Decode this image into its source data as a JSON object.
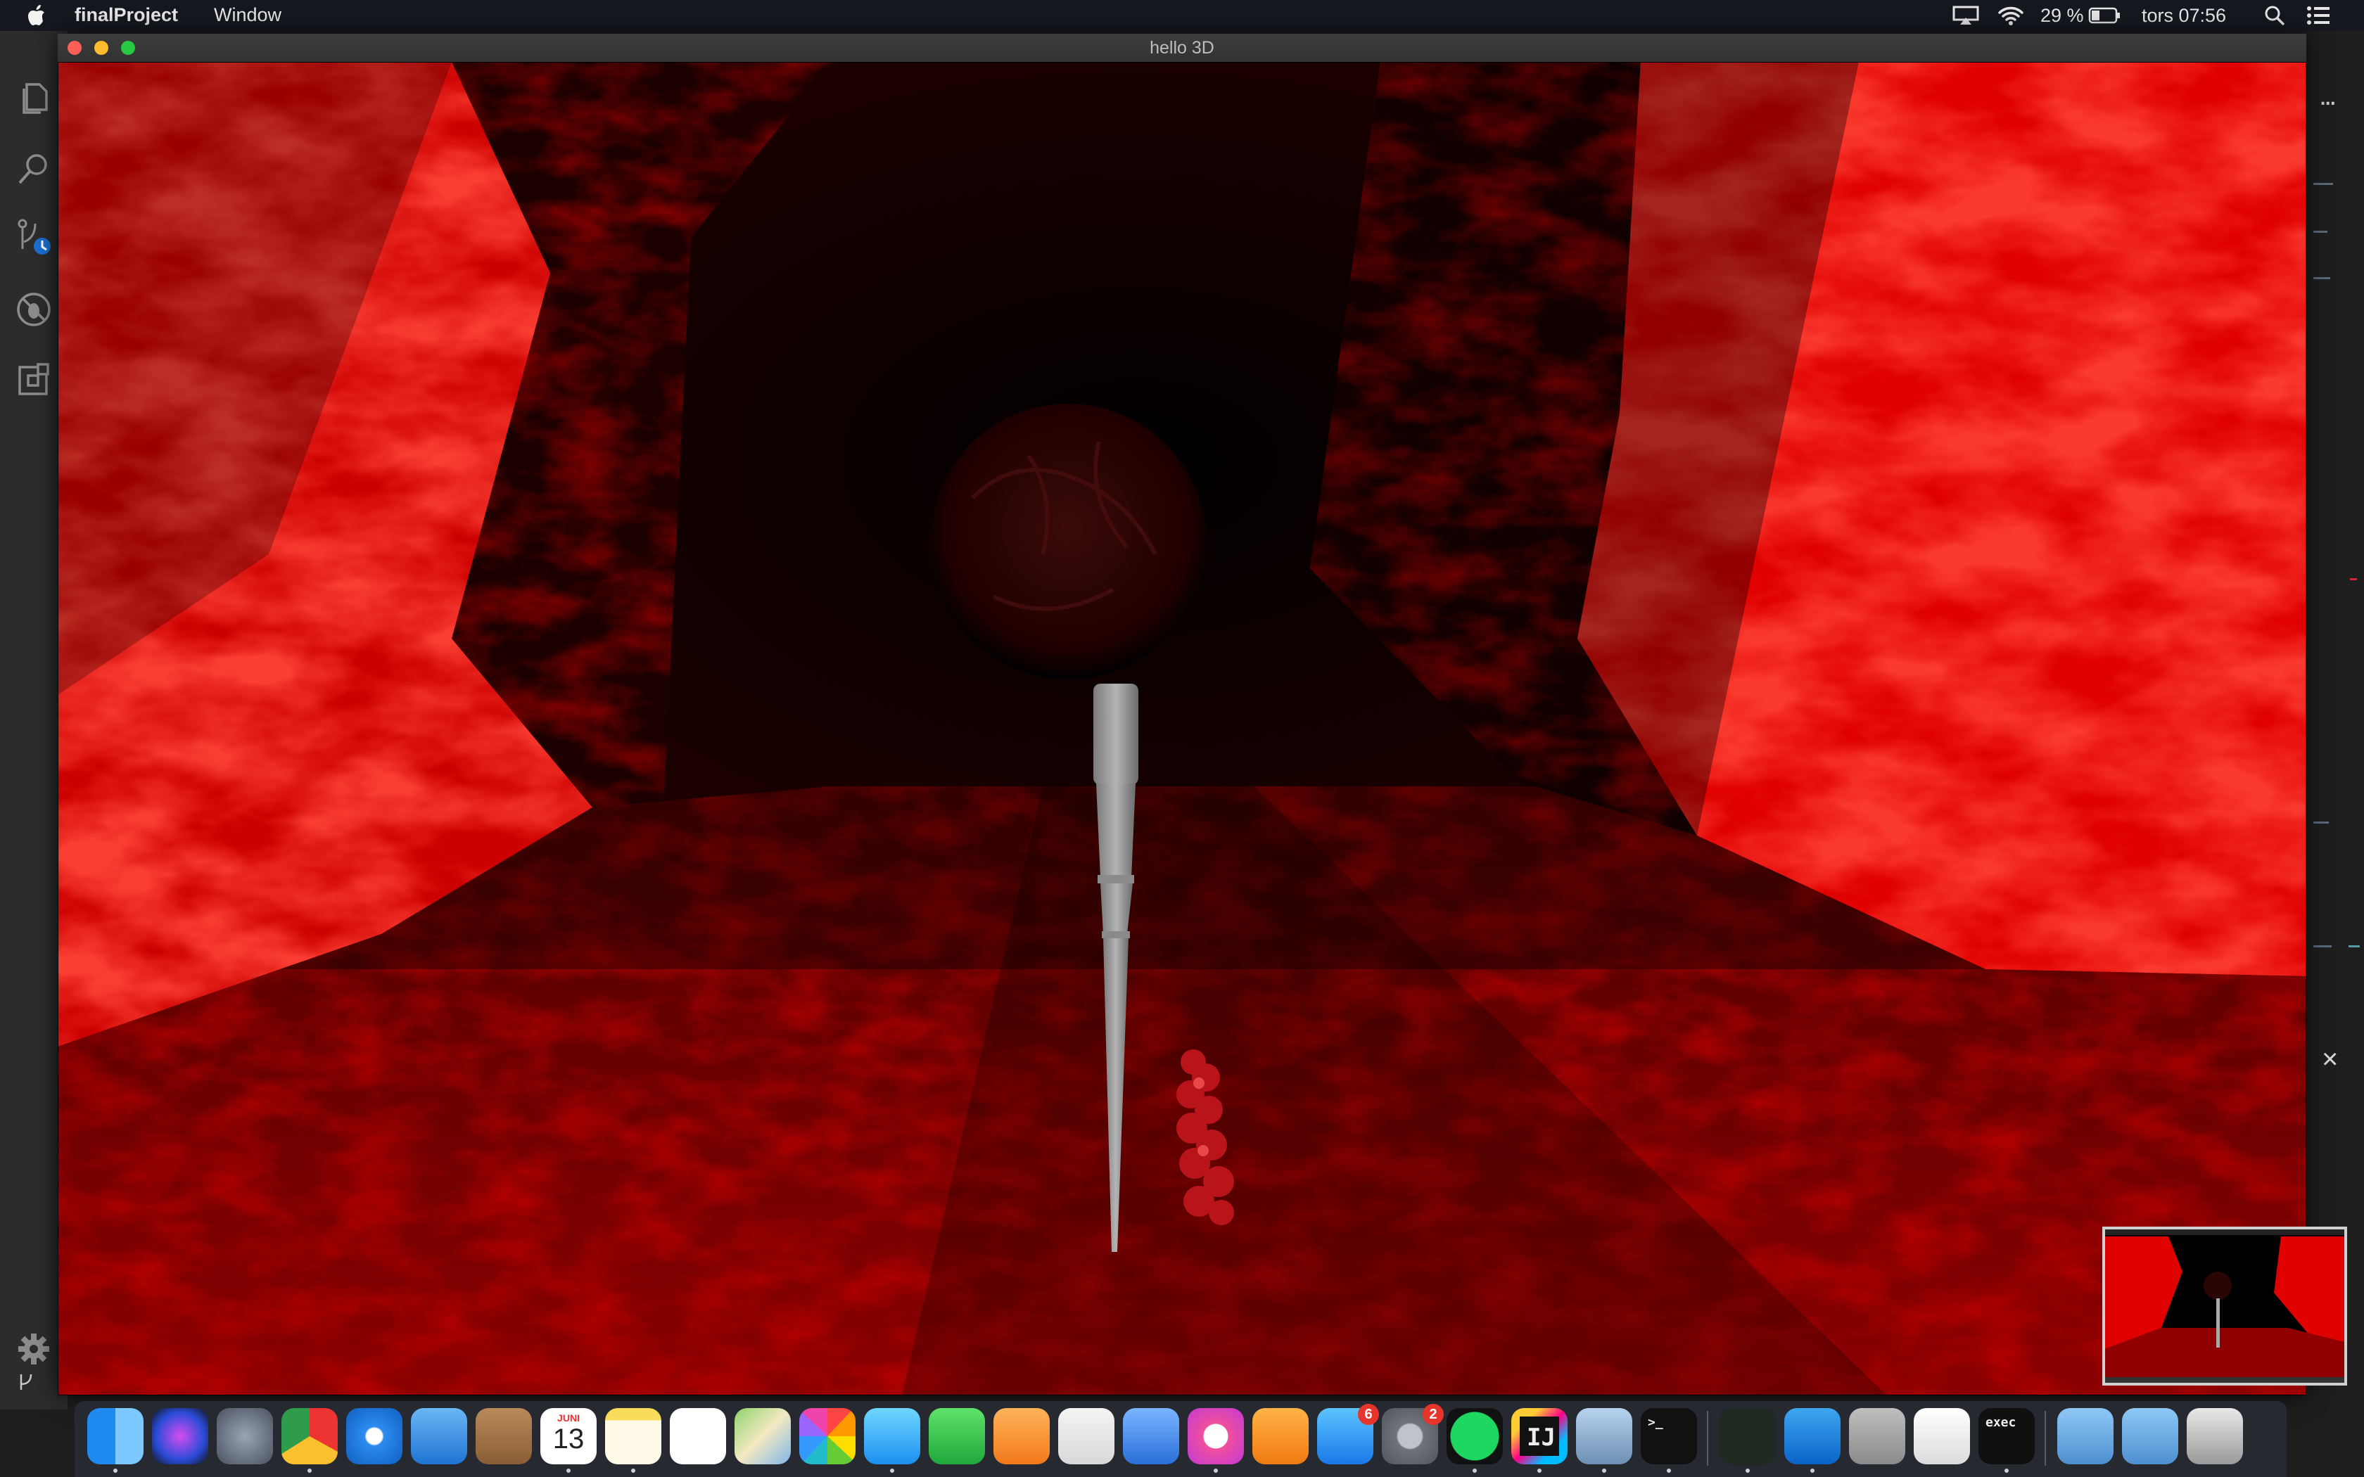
{
  "menubar": {
    "app_name": "finalProject",
    "menu_window": "Window",
    "battery": "29 %",
    "clock": "tors 07:56",
    "icons": [
      "apple-icon",
      "airplay-icon",
      "wifi-icon",
      "battery-icon",
      "spotlight-search-icon",
      "notification-center-icon"
    ]
  },
  "game_window": {
    "title": "hello 3D",
    "traffic_colors": {
      "close": "#ff5f57",
      "minimize": "#febc2e",
      "zoom": "#28c840"
    }
  },
  "vscode": {
    "activity_icons": [
      "explorer-icon",
      "search-icon",
      "source-control-icon",
      "debug-icon",
      "extensions-icon"
    ],
    "manage_icon": "gear-icon",
    "more_actions": "...",
    "close_panel": "×"
  },
  "scene": {
    "description_colors": {
      "lava_bright": "#ff1a10",
      "lava_dark": "#5a0000",
      "wand": "#a8a8a8"
    }
  },
  "dock": {
    "items": [
      {
        "name": "finder",
        "running": true
      },
      {
        "name": "siri",
        "running": false
      },
      {
        "name": "launchpad",
        "running": false
      },
      {
        "name": "chrome",
        "running": true
      },
      {
        "name": "safari",
        "running": false
      },
      {
        "name": "mail",
        "running": false
      },
      {
        "name": "contacts",
        "running": false
      },
      {
        "name": "calendar",
        "running": true,
        "month": "JUNI",
        "day": "13"
      },
      {
        "name": "notes",
        "running": true
      },
      {
        "name": "reminders",
        "running": false
      },
      {
        "name": "maps",
        "running": false
      },
      {
        "name": "photos",
        "running": false
      },
      {
        "name": "messages",
        "running": true
      },
      {
        "name": "facetime",
        "running": false
      },
      {
        "name": "pages",
        "running": false
      },
      {
        "name": "numbers",
        "running": false
      },
      {
        "name": "keynote",
        "running": false
      },
      {
        "name": "itunes",
        "running": true
      },
      {
        "name": "ibooks",
        "running": false
      },
      {
        "name": "app-store",
        "running": false,
        "badge": "6"
      },
      {
        "name": "system-preferences",
        "running": false,
        "badge": "2"
      },
      {
        "name": "spotify",
        "running": true
      },
      {
        "name": "intellij",
        "running": true,
        "label": "IJ"
      },
      {
        "name": "preview",
        "running": true
      },
      {
        "name": "terminal",
        "running": true,
        "label": ">_"
      },
      {
        "name": "activity-monitor",
        "running": true
      },
      {
        "name": "vscode",
        "running": true
      },
      {
        "name": "calculator",
        "running": false
      },
      {
        "name": "textedit",
        "running": false
      },
      {
        "name": "exec",
        "running": true,
        "label": "exec"
      },
      {
        "name": "downloads",
        "running": false
      },
      {
        "name": "documents",
        "running": false
      },
      {
        "name": "trash",
        "running": false
      }
    ]
  }
}
